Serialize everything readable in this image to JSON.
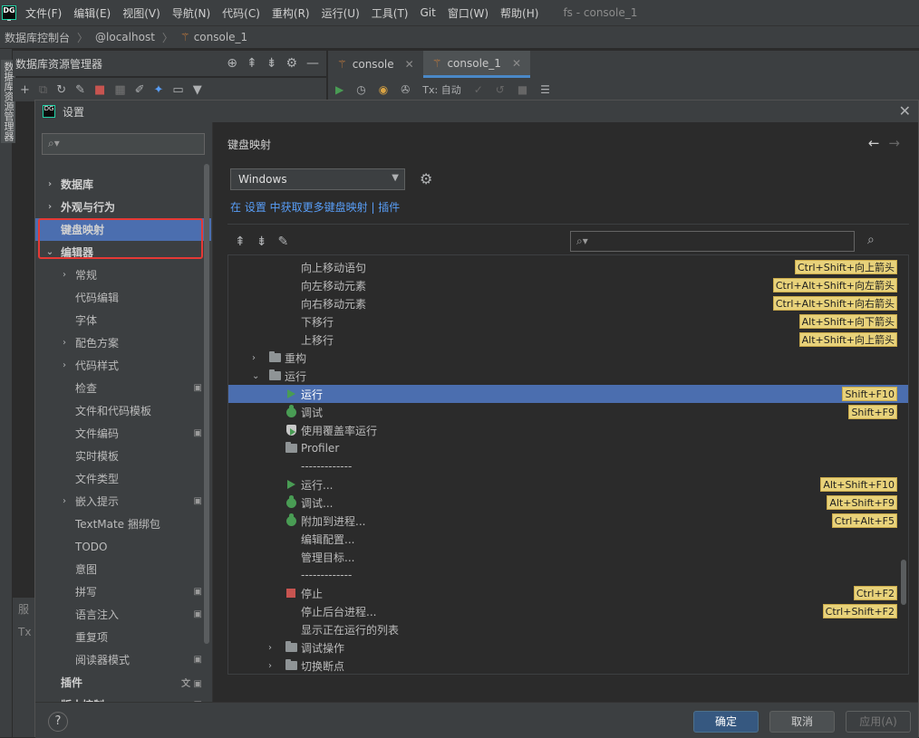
{
  "menubar": {
    "items": [
      "文件(F)",
      "编辑(E)",
      "视图(V)",
      "导航(N)",
      "代码(C)",
      "重构(R)",
      "运行(U)",
      "工具(T)",
      "Git",
      "窗口(W)",
      "帮助(H)"
    ],
    "window_title": "fs - console_1"
  },
  "breadcrumb": [
    "数据库控制台",
    "@localhost",
    "console_1"
  ],
  "left_strip_label": "数据库资源管理器",
  "db_panel": {
    "title": "数据库资源管理器"
  },
  "editor_tabs": [
    "console",
    "console_1"
  ],
  "editor_toolbar": {
    "tx_label": "Tx: 自动"
  },
  "bg_peek": [
    "服",
    "Tx"
  ],
  "dialog": {
    "title": "设置",
    "tree": [
      {
        "label": "数据库",
        "level": 0,
        "arrow": "›",
        "bold": true
      },
      {
        "label": "外观与行为",
        "level": 0,
        "arrow": "›",
        "bold": true
      },
      {
        "label": "键盘映射",
        "level": 0,
        "arrow": "",
        "bold": true,
        "selected": true
      },
      {
        "label": "编辑器",
        "level": 0,
        "arrow": "⌄",
        "bold": true
      },
      {
        "label": "常规",
        "level": 1,
        "arrow": "›"
      },
      {
        "label": "代码编辑",
        "level": 1,
        "arrow": ""
      },
      {
        "label": "字体",
        "level": 1,
        "arrow": ""
      },
      {
        "label": "配色方案",
        "level": 1,
        "arrow": "›"
      },
      {
        "label": "代码样式",
        "level": 1,
        "arrow": "›"
      },
      {
        "label": "检查",
        "level": 1,
        "arrow": "",
        "badge": "▣"
      },
      {
        "label": "文件和代码模板",
        "level": 1,
        "arrow": ""
      },
      {
        "label": "文件编码",
        "level": 1,
        "arrow": "",
        "badge": "▣"
      },
      {
        "label": "实时模板",
        "level": 1,
        "arrow": ""
      },
      {
        "label": "文件类型",
        "level": 1,
        "arrow": ""
      },
      {
        "label": "嵌入提示",
        "level": 1,
        "arrow": "›",
        "badge": "▣"
      },
      {
        "label": "TextMate 捆绑包",
        "level": 1,
        "arrow": ""
      },
      {
        "label": "TODO",
        "level": 1,
        "arrow": ""
      },
      {
        "label": "意图",
        "level": 1,
        "arrow": ""
      },
      {
        "label": "拼写",
        "level": 1,
        "arrow": "",
        "badge": "▣"
      },
      {
        "label": "语言注入",
        "level": 1,
        "arrow": "",
        "badge": "▣"
      },
      {
        "label": "重复项",
        "level": 1,
        "arrow": ""
      },
      {
        "label": "阅读器模式",
        "level": 1,
        "arrow": "",
        "badge": "▣"
      },
      {
        "label": "插件",
        "level": 0,
        "arrow": "",
        "bold": true,
        "badge": "文 ▣"
      },
      {
        "label": "版本控制",
        "level": 0,
        "arrow": "›",
        "bold": true,
        "badge": "▣"
      }
    ],
    "content": {
      "title": "键盘映射",
      "keymap_value": "Windows",
      "plugins_link": "在 设置 中获取更多键盘映射 | 插件",
      "actions": [
        {
          "label": "向上移动语句",
          "indent": 2,
          "icon": "",
          "exp": "",
          "shortcut": "Ctrl+Shift+向上箭头"
        },
        {
          "label": "向左移动元素",
          "indent": 2,
          "icon": "",
          "exp": "",
          "shortcut": "Ctrl+Alt+Shift+向左箭头"
        },
        {
          "label": "向右移动元素",
          "indent": 2,
          "icon": "",
          "exp": "",
          "shortcut": "Ctrl+Alt+Shift+向右箭头"
        },
        {
          "label": "下移行",
          "indent": 2,
          "icon": "",
          "exp": "",
          "shortcut": "Alt+Shift+向下箭头"
        },
        {
          "label": "上移行",
          "indent": 2,
          "icon": "",
          "exp": "",
          "shortcut": "Alt+Shift+向上箭头"
        },
        {
          "label": "重构",
          "indent": 1,
          "icon": "folder",
          "exp": "›",
          "shortcut": ""
        },
        {
          "label": "运行",
          "indent": 1,
          "icon": "folder",
          "exp": "⌄",
          "shortcut": ""
        },
        {
          "label": "运行",
          "indent": 2,
          "icon": "play",
          "exp": "",
          "shortcut": "Shift+F10",
          "selected": true
        },
        {
          "label": "调试",
          "indent": 2,
          "icon": "bug",
          "exp": "",
          "shortcut": "Shift+F9"
        },
        {
          "label": "使用覆盖率运行",
          "indent": 2,
          "icon": "shield",
          "exp": "",
          "shortcut": ""
        },
        {
          "label": "Profiler",
          "indent": 2,
          "icon": "folder",
          "exp": "",
          "shortcut": ""
        },
        {
          "label": "-------------",
          "indent": 2,
          "icon": "",
          "exp": "",
          "shortcut": ""
        },
        {
          "label": "运行...",
          "indent": 2,
          "icon": "play",
          "exp": "",
          "shortcut": "Alt+Shift+F10"
        },
        {
          "label": "调试...",
          "indent": 2,
          "icon": "bug",
          "exp": "",
          "shortcut": "Alt+Shift+F9"
        },
        {
          "label": "附加到进程...",
          "indent": 2,
          "icon": "bug",
          "exp": "",
          "shortcut": "Ctrl+Alt+F5"
        },
        {
          "label": "编辑配置...",
          "indent": 2,
          "icon": "",
          "exp": "",
          "shortcut": ""
        },
        {
          "label": "管理目标...",
          "indent": 2,
          "icon": "",
          "exp": "",
          "shortcut": ""
        },
        {
          "label": "-------------",
          "indent": 2,
          "icon": "",
          "exp": "",
          "shortcut": ""
        },
        {
          "label": "停止",
          "indent": 2,
          "icon": "stop",
          "exp": "",
          "shortcut": "Ctrl+F2"
        },
        {
          "label": "停止后台进程...",
          "indent": 2,
          "icon": "",
          "exp": "",
          "shortcut": "Ctrl+Shift+F2"
        },
        {
          "label": "显示正在运行的列表",
          "indent": 2,
          "icon": "",
          "exp": "",
          "shortcut": ""
        },
        {
          "label": "调试操作",
          "indent": 2,
          "icon": "folder",
          "exp": "›",
          "shortcut": ""
        },
        {
          "label": "切换断点",
          "indent": 2,
          "icon": "folder",
          "exp": "›",
          "shortcut": ""
        }
      ]
    },
    "footer": {
      "help": "?",
      "ok": "确定",
      "cancel": "取消",
      "apply": "应用(A)"
    }
  },
  "colors": {
    "selection": "#4b6eaf",
    "shortcut_bg": "#e8d27a",
    "link": "#589df6",
    "highlight_box": "#e53935"
  }
}
